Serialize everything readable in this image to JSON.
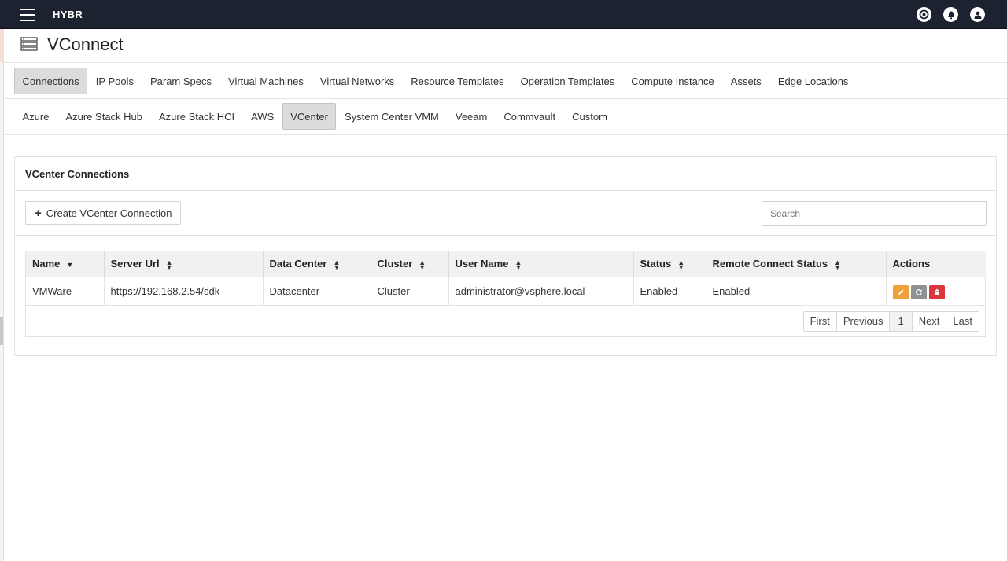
{
  "app": {
    "brand": "HYBR"
  },
  "page": {
    "title": "VConnect"
  },
  "main_tabs": [
    {
      "label": "Connections",
      "active": true
    },
    {
      "label": "IP Pools",
      "active": false
    },
    {
      "label": "Param Specs",
      "active": false
    },
    {
      "label": "Virtual Machines",
      "active": false
    },
    {
      "label": "Virtual Networks",
      "active": false
    },
    {
      "label": "Resource Templates",
      "active": false
    },
    {
      "label": "Operation Templates",
      "active": false
    },
    {
      "label": "Compute Instance",
      "active": false
    },
    {
      "label": "Assets",
      "active": false
    },
    {
      "label": "Edge Locations",
      "active": false
    }
  ],
  "sub_tabs": [
    {
      "label": "Azure",
      "active": false
    },
    {
      "label": "Azure Stack Hub",
      "active": false
    },
    {
      "label": "Azure Stack HCI",
      "active": false
    },
    {
      "label": "AWS",
      "active": false
    },
    {
      "label": "VCenter",
      "active": true
    },
    {
      "label": "System Center VMM",
      "active": false
    },
    {
      "label": "Veeam",
      "active": false
    },
    {
      "label": "Commvault",
      "active": false
    },
    {
      "label": "Custom",
      "active": false
    }
  ],
  "panel": {
    "title": "VCenter Connections",
    "create_label": "Create VCenter Connection",
    "search_placeholder": "Search"
  },
  "table": {
    "columns": [
      "Name",
      "Server Url",
      "Data Center",
      "Cluster",
      "User Name",
      "Status",
      "Remote Connect Status",
      "Actions"
    ],
    "rows": [
      {
        "name": "VMWare",
        "server_url": "https://192.168.2.54/sdk",
        "data_center": "Datacenter",
        "cluster": "Cluster",
        "user_name": "administrator@vsphere.local",
        "status": "Enabled",
        "remote_connect_status": "Enabled",
        "actions": [
          "pencil-icon",
          "refresh-icon",
          "trash-icon"
        ]
      }
    ]
  },
  "pagination": {
    "first": "First",
    "previous": "Previous",
    "current": "1",
    "next": "Next",
    "last": "Last"
  },
  "top_icons": [
    "globe-icon",
    "bell-icon",
    "user-icon"
  ],
  "colors": {
    "topbar": "#1d2230",
    "edit": "#f0a13a",
    "refresh": "#8f9295",
    "delete": "#d9363e",
    "active_tab": "#dcdcdc"
  }
}
